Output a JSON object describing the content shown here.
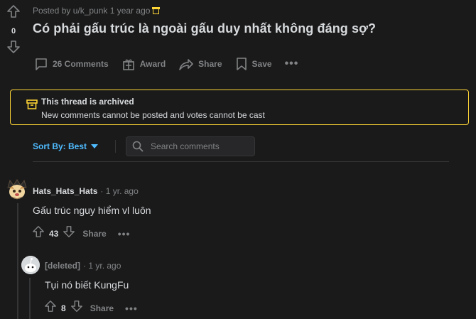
{
  "post": {
    "score": "0",
    "meta": "Posted by u/k_punk 1 year ago",
    "title": "Có phải gấu trúc là ngoài gấu duy nhất không đáng sợ?",
    "actions": {
      "comments": "26 Comments",
      "award": "Award",
      "share": "Share",
      "save": "Save",
      "more": "•••"
    }
  },
  "archived": {
    "heading": "This thread is archived",
    "message": "New comments cannot be posted and votes cannot be cast"
  },
  "sort": {
    "label": "Sort By: Best",
    "search_placeholder": "Search comments"
  },
  "comments": [
    {
      "author": "Hats_Hats_Hats",
      "time": "· 1 yr. ago",
      "body": "Gấu trúc nguy hiểm vl luôn",
      "score": "43",
      "share": "Share",
      "more": "•••"
    },
    {
      "author": "[deleted]",
      "time": "· 1 yr. ago",
      "body": "Tụi nó biết KungFu",
      "score": "8",
      "share": "Share",
      "more": "•••"
    }
  ],
  "colors": {
    "background": "#1a1a1b",
    "text": "#d7dadc",
    "muted": "#818384",
    "accent": "#4fbcff",
    "archived_border": "#ffd635"
  }
}
